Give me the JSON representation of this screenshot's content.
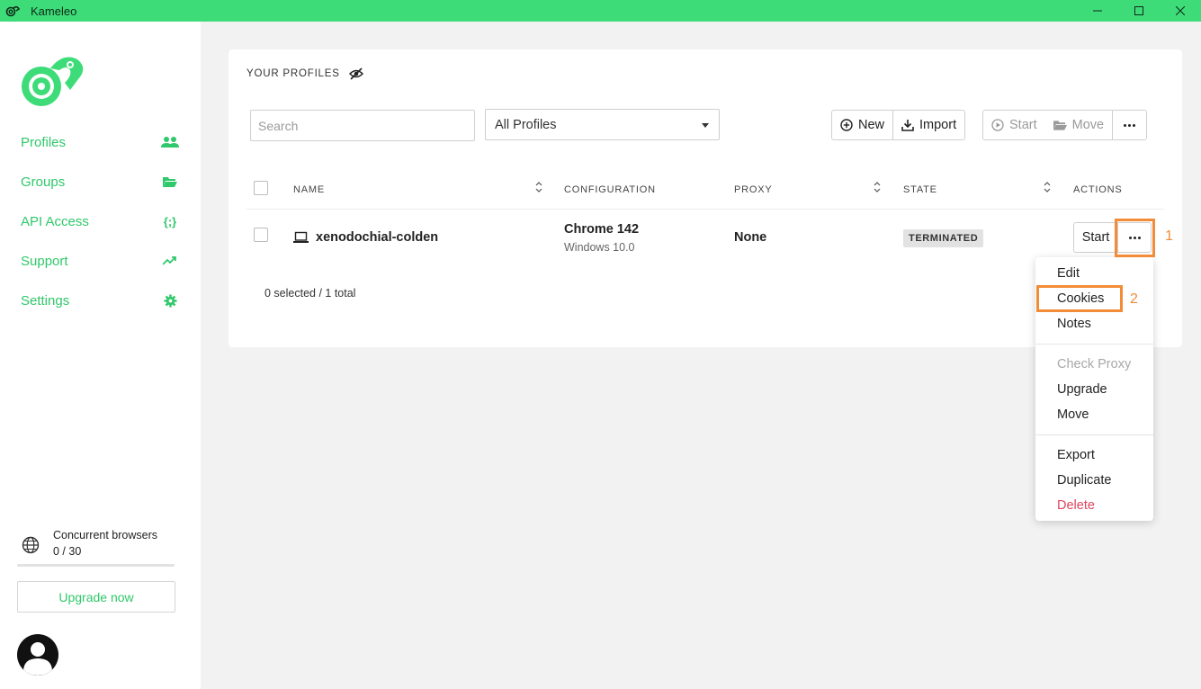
{
  "window": {
    "title": "Kameleo",
    "controls": [
      "—",
      "☐",
      "✕"
    ]
  },
  "sidebar": {
    "nav": [
      {
        "label": "Profiles",
        "icon": "users-icon"
      },
      {
        "label": "Groups",
        "icon": "folder-icon"
      },
      {
        "label": "API Access",
        "icon": "api-braces-icon"
      },
      {
        "label": "Support",
        "icon": "trending-up-icon"
      },
      {
        "label": "Settings",
        "icon": "gear-icon"
      }
    ],
    "concurrent": {
      "label": "Concurrent browsers",
      "value": "0 / 30",
      "fraction": 0
    },
    "upgrade_label": "Upgrade now"
  },
  "panel": {
    "title": "YOUR PROFILES",
    "search_placeholder": "Search",
    "filter_selected": "All Profiles",
    "toolbar": {
      "new_label": "New",
      "import_label": "Import",
      "start_label": "Start",
      "move_label": "Move"
    },
    "columns": {
      "name": "NAME",
      "configuration": "CONFIGURATION",
      "proxy": "PROXY",
      "state": "STATE",
      "actions": "ACTIONS"
    },
    "rows": [
      {
        "name": "xenodochial-colden",
        "browser": "Chrome 142",
        "os": "Windows 10.0",
        "proxy": "None",
        "state": "TERMINATED",
        "start_label": "Start"
      }
    ],
    "selection_summary": "0 selected / 1 total"
  },
  "menu": {
    "items": [
      {
        "label": "Edit"
      },
      {
        "label": "Cookies"
      },
      {
        "label": "Notes"
      },
      {
        "label": "Check Proxy",
        "disabled": true
      },
      {
        "label": "Upgrade"
      },
      {
        "label": "Move"
      },
      {
        "label": "Export"
      },
      {
        "label": "Duplicate"
      },
      {
        "label": "Delete",
        "danger": true
      }
    ]
  },
  "annotations": {
    "step1": "1",
    "step2": "2"
  },
  "colors": {
    "brand_green": "#3ddc78",
    "link_green": "#2fc86a",
    "highlight_orange": "#f28c38",
    "danger_red": "#e2445c"
  }
}
